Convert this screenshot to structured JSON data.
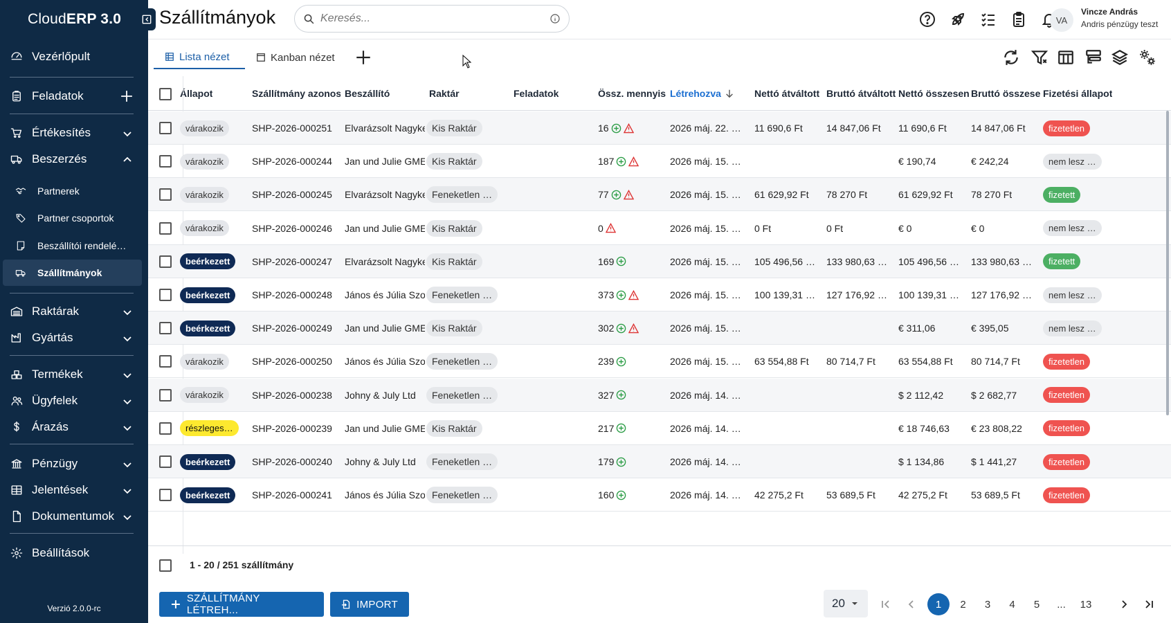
{
  "app": {
    "name_prefix": "Cloud",
    "name_bold": "ERP 3.0",
    "version": "Verzió 2.0.0-rc"
  },
  "sidebar": {
    "items": [
      {
        "label": "Vezérlőpult",
        "icon": "dashboard-icon"
      },
      {
        "label": "Feladatok",
        "icon": "clipboard-icon"
      },
      {
        "label": "Értékesítés",
        "icon": "cart-icon"
      },
      {
        "label": "Beszerzés",
        "icon": "truck-icon"
      },
      {
        "label": "Raktárak",
        "icon": "warehouse-icon"
      },
      {
        "label": "Gyártás",
        "icon": "factory-icon"
      },
      {
        "label": "Termékek",
        "icon": "boxes-icon"
      },
      {
        "label": "Ügyfelek",
        "icon": "users-icon"
      },
      {
        "label": "Árazás",
        "icon": "dollar-icon"
      },
      {
        "label": "Pénzügy",
        "icon": "bank-icon"
      },
      {
        "label": "Jelentések",
        "icon": "table-icon"
      },
      {
        "label": "Dokumentumok",
        "icon": "document-icon"
      },
      {
        "label": "Beállítások",
        "icon": "gear-icon"
      }
    ],
    "subitems": [
      {
        "label": "Partnerek",
        "icon": "partners-icon"
      },
      {
        "label": "Partner csoportok",
        "icon": "tag-icon"
      },
      {
        "label": "Beszállítói rendelé…",
        "icon": "order-icon"
      },
      {
        "label": "Szállítmányok",
        "icon": "shipment-icon"
      }
    ]
  },
  "header": {
    "title": "Szállítmányok",
    "search_placeholder": "Keresés...",
    "user": {
      "initials": "VA",
      "name": "Vincze András",
      "org": "Andris pénzügy teszt"
    }
  },
  "tabs": [
    {
      "label": "Lista nézet"
    },
    {
      "label": "Kanban nézet"
    }
  ],
  "table": {
    "columns": [
      "Állapot",
      "Szállítmány azonos",
      "Beszállító",
      "Raktár",
      "Feladatok",
      "Össz. mennyis",
      "Létrehozva",
      "Nettó átváltott",
      "Bruttó átváltott",
      "Nettó összesen",
      "Bruttó összese",
      "Fizetési állapot"
    ],
    "rows": [
      {
        "status": "várakozik",
        "st": "wait",
        "id": "SHP-2026-000251",
        "supplier": "Elvarázsolt Nagyke",
        "warehouse": "Kis Raktár",
        "qty": "16",
        "plus": true,
        "warn": true,
        "created": "2026 máj. 22. …",
        "net_conv": "11 690,6  Ft",
        "gross_conv": "14 847,06  Ft",
        "net": "11 690,6  Ft",
        "gross": "14 847,06  Ft",
        "payment": "fizetetlen",
        "pay": "unpaid"
      },
      {
        "status": "várakozik",
        "st": "wait",
        "id": "SHP-2026-000244",
        "supplier": "Jan und Julie GME",
        "warehouse": "Kis Raktár",
        "qty": "187",
        "plus": true,
        "warn": true,
        "created": "2026 máj. 15. …",
        "net_conv": "",
        "gross_conv": "",
        "net": "€ 190,74",
        "gross": "€ 242,24",
        "payment": "nem lesz …",
        "pay": "none"
      },
      {
        "status": "várakozik",
        "st": "wait",
        "id": "SHP-2026-000245",
        "supplier": "Elvarázsolt Nagyke",
        "warehouse": "Feneketlen …",
        "qty": "77",
        "plus": true,
        "warn": true,
        "created": "2026 máj. 15. …",
        "net_conv": "61 629,92  Ft",
        "gross_conv": "78 270  Ft",
        "net": "61 629,92  Ft",
        "gross": "78 270  Ft",
        "payment": "fizetett",
        "pay": "paid"
      },
      {
        "status": "várakozik",
        "st": "wait",
        "id": "SHP-2026-000246",
        "supplier": "Jan und Julie GME",
        "warehouse": "Kis Raktár",
        "qty": "0",
        "plus": false,
        "warn": true,
        "created": "2026 máj. 15. …",
        "net_conv": "0  Ft",
        "gross_conv": "0  Ft",
        "net": "€ 0",
        "gross": "€ 0",
        "payment": "nem lesz …",
        "pay": "none"
      },
      {
        "status": "beérkezett",
        "st": "done",
        "id": "SHP-2026-000247",
        "supplier": "Elvarázsolt Nagyke",
        "warehouse": "Kis Raktár",
        "qty": "169",
        "plus": true,
        "warn": false,
        "created": "2026 máj. 15. …",
        "net_conv": "105 496,56 …",
        "gross_conv": "133 980,63 …",
        "net": "105 496,56 …",
        "gross": "133 980,63 …",
        "payment": "fizetett",
        "pay": "paid"
      },
      {
        "status": "beérkezett",
        "st": "done",
        "id": "SHP-2026-000248",
        "supplier": "János és Júlia Szo",
        "warehouse": "Feneketlen …",
        "qty": "373",
        "plus": true,
        "warn": true,
        "created": "2026 máj. 15. …",
        "net_conv": "100 139,31 …",
        "gross_conv": "127 176,92 …",
        "net": "100 139,31 …",
        "gross": "127 176,92 …",
        "payment": "nem lesz …",
        "pay": "none"
      },
      {
        "status": "beérkezett",
        "st": "done",
        "id": "SHP-2026-000249",
        "supplier": "Jan und Julie GME",
        "warehouse": "Kis Raktár",
        "qty": "302",
        "plus": true,
        "warn": true,
        "created": "2026 máj. 15. …",
        "net_conv": "",
        "gross_conv": "",
        "net": "€ 311,06",
        "gross": "€ 395,05",
        "payment": "nem lesz …",
        "pay": "none"
      },
      {
        "status": "várakozik",
        "st": "wait",
        "id": "SHP-2026-000250",
        "supplier": "János és Júlia Szo",
        "warehouse": "Feneketlen …",
        "qty": "239",
        "plus": true,
        "warn": false,
        "created": "2026 máj. 15. …",
        "net_conv": "63 554,88  Ft",
        "gross_conv": "80 714,7  Ft",
        "net": "63 554,88  Ft",
        "gross": "80 714,7  Ft",
        "payment": "fizetetlen",
        "pay": "unpaid"
      },
      {
        "status": "várakozik",
        "st": "wait",
        "id": "SHP-2026-000238",
        "supplier": "Johny & July Ltd",
        "warehouse": "Feneketlen …",
        "qty": "327",
        "plus": true,
        "warn": false,
        "created": "2026 máj. 14. …",
        "net_conv": "",
        "gross_conv": "",
        "net": "$ 2 112,42",
        "gross": "$ 2 682,77",
        "payment": "fizetetlen",
        "pay": "unpaid"
      },
      {
        "status": "részleges…",
        "st": "part",
        "id": "SHP-2026-000239",
        "supplier": "Jan und Julie GME",
        "warehouse": "Kis Raktár",
        "qty": "217",
        "plus": true,
        "warn": false,
        "created": "2026 máj. 14. …",
        "net_conv": "",
        "gross_conv": "",
        "net": "€ 18 746,63",
        "gross": "€ 23 808,22",
        "payment": "fizetetlen",
        "pay": "unpaid"
      },
      {
        "status": "beérkezett",
        "st": "done",
        "id": "SHP-2026-000240",
        "supplier": "Johny & July Ltd",
        "warehouse": "Feneketlen …",
        "qty": "179",
        "plus": true,
        "warn": false,
        "created": "2026 máj. 14. …",
        "net_conv": "",
        "gross_conv": "",
        "net": "$ 1 134,86",
        "gross": "$ 1 441,27",
        "payment": "fizetetlen",
        "pay": "unpaid"
      },
      {
        "status": "beérkezett",
        "st": "done",
        "id": "SHP-2026-000241",
        "supplier": "János és Júlia Szo",
        "warehouse": "Feneketlen …",
        "qty": "160",
        "plus": true,
        "warn": false,
        "created": "2026 máj. 14. …",
        "net_conv": "42 275,2  Ft",
        "gross_conv": "53 689,5  Ft",
        "net": "42 275,2  Ft",
        "gross": "53 689,5  Ft",
        "payment": "fizetetlen",
        "pay": "unpaid"
      }
    ],
    "count_label": "1 - 20 / 251 szállítmány"
  },
  "bottom": {
    "create_label": "SZÁLLÍTMÁNY LÉTREH...",
    "import_label": "IMPORT",
    "page_size": "20",
    "pages": [
      "1",
      "2",
      "3",
      "4",
      "5",
      "...",
      "13"
    ]
  },
  "colors": {
    "sidebar_bg": "#0f2a45",
    "primary": "#1565b0",
    "unpaid": "#ef5350",
    "paid": "#4caf63",
    "partial": "#fde92f"
  }
}
